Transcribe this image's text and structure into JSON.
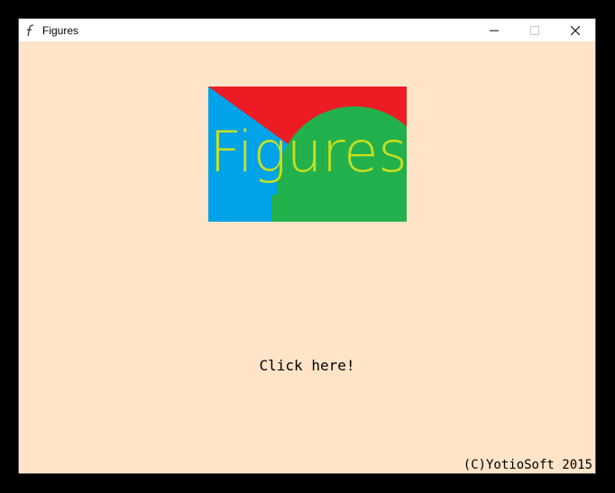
{
  "window": {
    "title": "Figures",
    "icon": "figures-app-icon",
    "controls": {
      "minimize_icon": "minimize-icon",
      "maximize_icon": "maximize-icon",
      "close_icon": "close-icon"
    }
  },
  "logo": {
    "text": "Figures",
    "colors": {
      "red": "#ed1c24",
      "blue": "#00a2e8",
      "green": "#22b14c",
      "text": "#c8e020"
    }
  },
  "main": {
    "prompt": "Click here!"
  },
  "footer": {
    "copyright": "(C)YotioSoft 2015"
  },
  "colors": {
    "background": "#ffe4c8",
    "titlebar": "#ffffff"
  }
}
